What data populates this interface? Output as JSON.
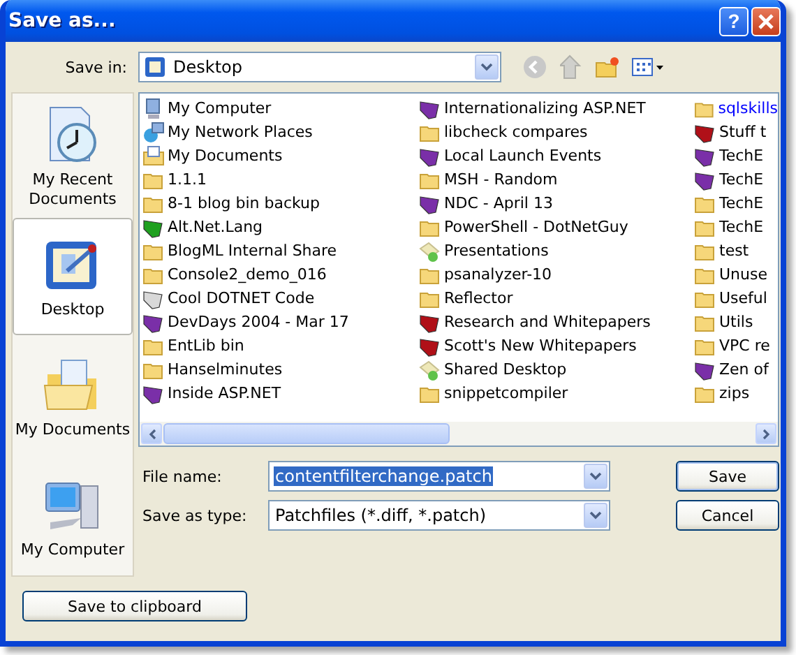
{
  "window": {
    "title": "Save as..."
  },
  "title_buttons": [
    {
      "kind": "help",
      "label": "?"
    },
    {
      "kind": "close"
    }
  ],
  "save_in": {
    "label": "Save in:",
    "value": "Desktop"
  },
  "places": [
    {
      "label": "My Recent Documents",
      "kind": "recent",
      "selected": false
    },
    {
      "label": "Desktop",
      "kind": "desktop",
      "selected": true
    },
    {
      "label": "My Documents",
      "kind": "documents",
      "selected": false
    },
    {
      "label": "My Computer",
      "kind": "computer",
      "selected": false
    }
  ],
  "files": [
    [
      {
        "label": "My Computer",
        "kind": "computer"
      },
      {
        "label": "My Network Places",
        "kind": "network"
      },
      {
        "label": "My Documents",
        "kind": "documents"
      },
      {
        "label": "1.1.1",
        "kind": "folder"
      },
      {
        "label": "8-1 blog bin backup",
        "kind": "folder"
      },
      {
        "label": "Alt.Net.Lang",
        "kind": "tagged",
        "color": "#1ea01e"
      },
      {
        "label": "BlogML Internal Share",
        "kind": "folder"
      },
      {
        "label": "Console2_demo_016",
        "kind": "folder"
      },
      {
        "label": "Cool DOTNET Code",
        "kind": "tagged",
        "color": "#d8d8d8"
      },
      {
        "label": "DevDays 2004 - Mar 17",
        "kind": "tagged",
        "color": "#7a2fa8"
      },
      {
        "label": "EntLib bin",
        "kind": "folder"
      },
      {
        "label": "Hanselminutes",
        "kind": "folder"
      },
      {
        "label": "Inside ASP.NET",
        "kind": "tagged",
        "color": "#7a2fa8"
      }
    ],
    [
      {
        "label": "Internationalizing ASP.NET",
        "kind": "tagged",
        "color": "#7a2fa8"
      },
      {
        "label": "libcheck compares",
        "kind": "folder"
      },
      {
        "label": "Local Launch Events",
        "kind": "tagged",
        "color": "#7a2fa8"
      },
      {
        "label": "MSH - Random",
        "kind": "folder"
      },
      {
        "label": "NDC - April 13",
        "kind": "tagged",
        "color": "#7a2fa8"
      },
      {
        "label": "PowerShell - DotNetGuy",
        "kind": "folder"
      },
      {
        "label": "Presentations",
        "kind": "shared"
      },
      {
        "label": "psanalyzer-10",
        "kind": "folder"
      },
      {
        "label": "Reflector",
        "kind": "folder"
      },
      {
        "label": "Research and Whitepapers",
        "kind": "tagged",
        "color": "#b01018"
      },
      {
        "label": "Scott's New Whitepapers",
        "kind": "tagged",
        "color": "#b01018"
      },
      {
        "label": "Shared Desktop",
        "kind": "shared"
      },
      {
        "label": "snippetcompiler",
        "kind": "folder"
      }
    ],
    [
      {
        "label": "sqlskills",
        "kind": "folder",
        "compressed": true
      },
      {
        "label": "Stuff t",
        "kind": "tagged",
        "color": "#b01018"
      },
      {
        "label": "TechE",
        "kind": "tagged",
        "color": "#7a2fa8"
      },
      {
        "label": "TechE",
        "kind": "tagged",
        "color": "#7a2fa8"
      },
      {
        "label": "TechE",
        "kind": "folder"
      },
      {
        "label": "TechE",
        "kind": "folder"
      },
      {
        "label": "test",
        "kind": "folder"
      },
      {
        "label": "Unuse",
        "kind": "folder"
      },
      {
        "label": "Useful",
        "kind": "folder"
      },
      {
        "label": "Utils",
        "kind": "folder"
      },
      {
        "label": "VPC re",
        "kind": "folder"
      },
      {
        "label": "Zen of",
        "kind": "tagged",
        "color": "#7a2fa8"
      },
      {
        "label": "zips",
        "kind": "folder"
      }
    ]
  ],
  "file_name": {
    "label": "File name:",
    "value": "contentfilterchange.patch",
    "selected": true
  },
  "save_as_type": {
    "label": "Save as type:",
    "value": "Patchfiles (*.diff, *.patch)"
  },
  "buttons": [
    {
      "label": "Save",
      "default": true
    },
    {
      "label": "Cancel",
      "default": false
    }
  ],
  "clipboard_button": {
    "label": "Save to clipboard"
  }
}
